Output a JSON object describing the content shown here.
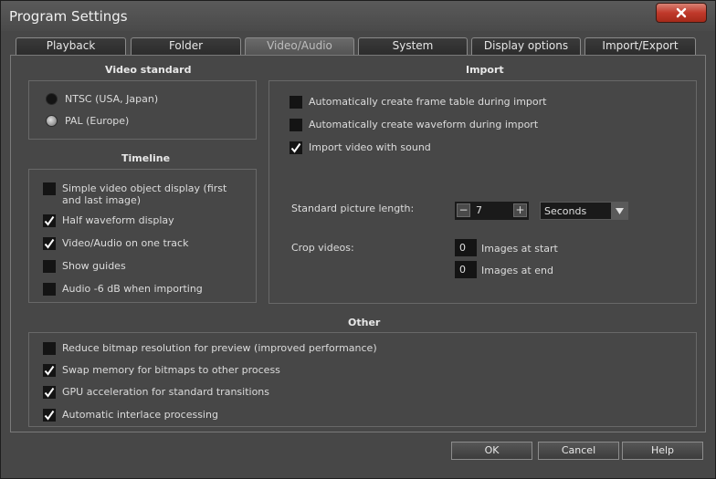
{
  "window": {
    "title": "Program Settings"
  },
  "tabs": [
    {
      "label": "Playback"
    },
    {
      "label": "Folder"
    },
    {
      "label": "Video/Audio",
      "active": true
    },
    {
      "label": "System"
    },
    {
      "label": "Display options"
    },
    {
      "label": "Import/Export"
    }
  ],
  "video_standard": {
    "heading": "Video standard",
    "options": [
      {
        "label": "NTSC (USA, Japan)",
        "selected": false
      },
      {
        "label": "PAL (Europe)",
        "selected": true
      }
    ]
  },
  "timeline": {
    "heading": "Timeline",
    "items": [
      {
        "label": "Simple video object display (first and last image)",
        "checked": false
      },
      {
        "label": "Half waveform display",
        "checked": true
      },
      {
        "label": "Video/Audio on one track",
        "checked": true
      },
      {
        "label": "Show guides",
        "checked": false
      },
      {
        "label": "Audio -6 dB when importing",
        "checked": false
      }
    ]
  },
  "import": {
    "heading": "Import",
    "items": [
      {
        "label": "Automatically create frame table during import",
        "checked": false
      },
      {
        "label": "Automatically create waveform during import",
        "checked": false
      },
      {
        "label": "Import video with sound",
        "checked": true
      }
    ],
    "picture_length": {
      "label": "Standard picture length:",
      "value": "7",
      "minus": "−",
      "plus": "+",
      "unit": "Seconds"
    },
    "crop": {
      "label": "Crop videos:",
      "start_value": "0",
      "start_label": "Images at start",
      "end_value": "0",
      "end_label": "Images at end"
    }
  },
  "other": {
    "heading": "Other",
    "items": [
      {
        "label": "Reduce bitmap resolution for preview (improved performance)",
        "checked": false
      },
      {
        "label": "Swap memory for bitmaps to other process",
        "checked": true
      },
      {
        "label": "GPU acceleration for standard transitions",
        "checked": true
      },
      {
        "label": "Automatic interlace processing",
        "checked": true
      }
    ]
  },
  "buttons": {
    "ok": "OK",
    "cancel": "Cancel",
    "help": "Help"
  },
  "colors": {
    "close_red": "#c0392b",
    "panel_bg": "#474747",
    "checkbox_bg": "#141414"
  }
}
